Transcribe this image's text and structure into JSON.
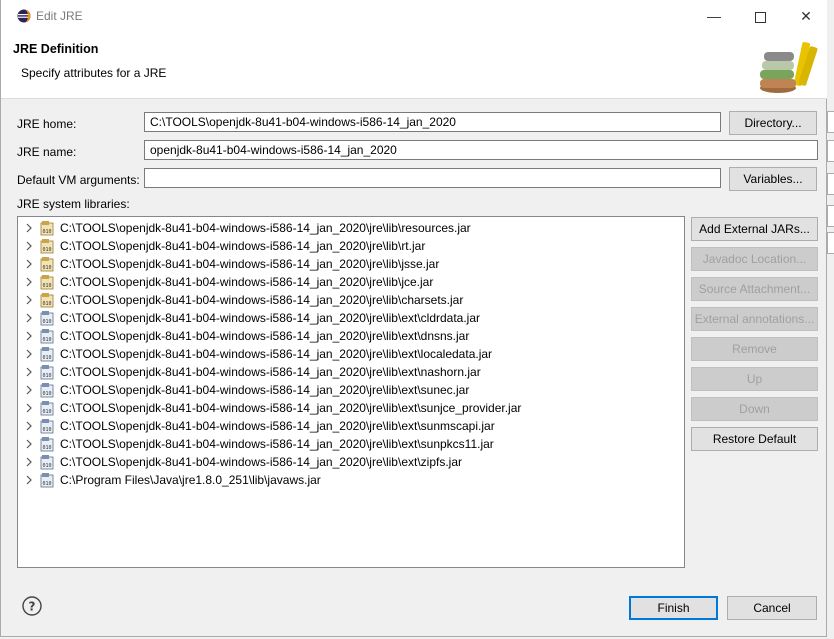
{
  "window": {
    "title": "Edit JRE"
  },
  "header": {
    "title": "JRE Definition",
    "subtitle": "Specify attributes for a JRE"
  },
  "form": {
    "jre_home_label": "JRE home:",
    "jre_home_value": "C:\\TOOLS\\openjdk-8u41-b04-windows-i586-14_jan_2020",
    "directory_button": "Directory...",
    "jre_name_label": "JRE name:",
    "jre_name_value": "openjdk-8u41-b04-windows-i586-14_jan_2020",
    "vm_args_label": "Default VM arguments:",
    "vm_args_value": "",
    "variables_button": "Variables...",
    "libraries_label": "JRE system libraries:"
  },
  "libraries": [
    {
      "path": "C:\\TOOLS\\openjdk-8u41-b04-windows-i586-14_jan_2020\\jre\\lib\\resources.jar",
      "icon": "jar-source-icon"
    },
    {
      "path": "C:\\TOOLS\\openjdk-8u41-b04-windows-i586-14_jan_2020\\jre\\lib\\rt.jar",
      "icon": "jar-source-icon"
    },
    {
      "path": "C:\\TOOLS\\openjdk-8u41-b04-windows-i586-14_jan_2020\\jre\\lib\\jsse.jar",
      "icon": "jar-source-icon"
    },
    {
      "path": "C:\\TOOLS\\openjdk-8u41-b04-windows-i586-14_jan_2020\\jre\\lib\\jce.jar",
      "icon": "jar-source-icon"
    },
    {
      "path": "C:\\TOOLS\\openjdk-8u41-b04-windows-i586-14_jan_2020\\jre\\lib\\charsets.jar",
      "icon": "jar-source-icon"
    },
    {
      "path": "C:\\TOOLS\\openjdk-8u41-b04-windows-i586-14_jan_2020\\jre\\lib\\ext\\cldrdata.jar",
      "icon": "jar-binary-icon"
    },
    {
      "path": "C:\\TOOLS\\openjdk-8u41-b04-windows-i586-14_jan_2020\\jre\\lib\\ext\\dnsns.jar",
      "icon": "jar-binary-icon"
    },
    {
      "path": "C:\\TOOLS\\openjdk-8u41-b04-windows-i586-14_jan_2020\\jre\\lib\\ext\\localedata.jar",
      "icon": "jar-binary-icon"
    },
    {
      "path": "C:\\TOOLS\\openjdk-8u41-b04-windows-i586-14_jan_2020\\jre\\lib\\ext\\nashorn.jar",
      "icon": "jar-binary-icon"
    },
    {
      "path": "C:\\TOOLS\\openjdk-8u41-b04-windows-i586-14_jan_2020\\jre\\lib\\ext\\sunec.jar",
      "icon": "jar-binary-icon"
    },
    {
      "path": "C:\\TOOLS\\openjdk-8u41-b04-windows-i586-14_jan_2020\\jre\\lib\\ext\\sunjce_provider.jar",
      "icon": "jar-binary-icon"
    },
    {
      "path": "C:\\TOOLS\\openjdk-8u41-b04-windows-i586-14_jan_2020\\jre\\lib\\ext\\sunmscapi.jar",
      "icon": "jar-binary-icon"
    },
    {
      "path": "C:\\TOOLS\\openjdk-8u41-b04-windows-i586-14_jan_2020\\jre\\lib\\ext\\sunpkcs11.jar",
      "icon": "jar-binary-icon"
    },
    {
      "path": "C:\\TOOLS\\openjdk-8u41-b04-windows-i586-14_jan_2020\\jre\\lib\\ext\\zipfs.jar",
      "icon": "jar-binary-icon"
    },
    {
      "path": "C:\\Program Files\\Java\\jre1.8.0_251\\lib\\javaws.jar",
      "icon": "jar-binary-icon"
    }
  ],
  "side_buttons": {
    "add_external_jars": "Add External JARs...",
    "javadoc_location": "Javadoc Location...",
    "source_attachment": "Source Attachment...",
    "external_annotations": "External annotations...",
    "remove": "Remove",
    "up": "Up",
    "down": "Down",
    "restore_default": "Restore Default"
  },
  "footer": {
    "finish": "Finish",
    "cancel": "Cancel"
  },
  "colors": {
    "accent": "#0078d7",
    "background": "#f0f0f0"
  }
}
